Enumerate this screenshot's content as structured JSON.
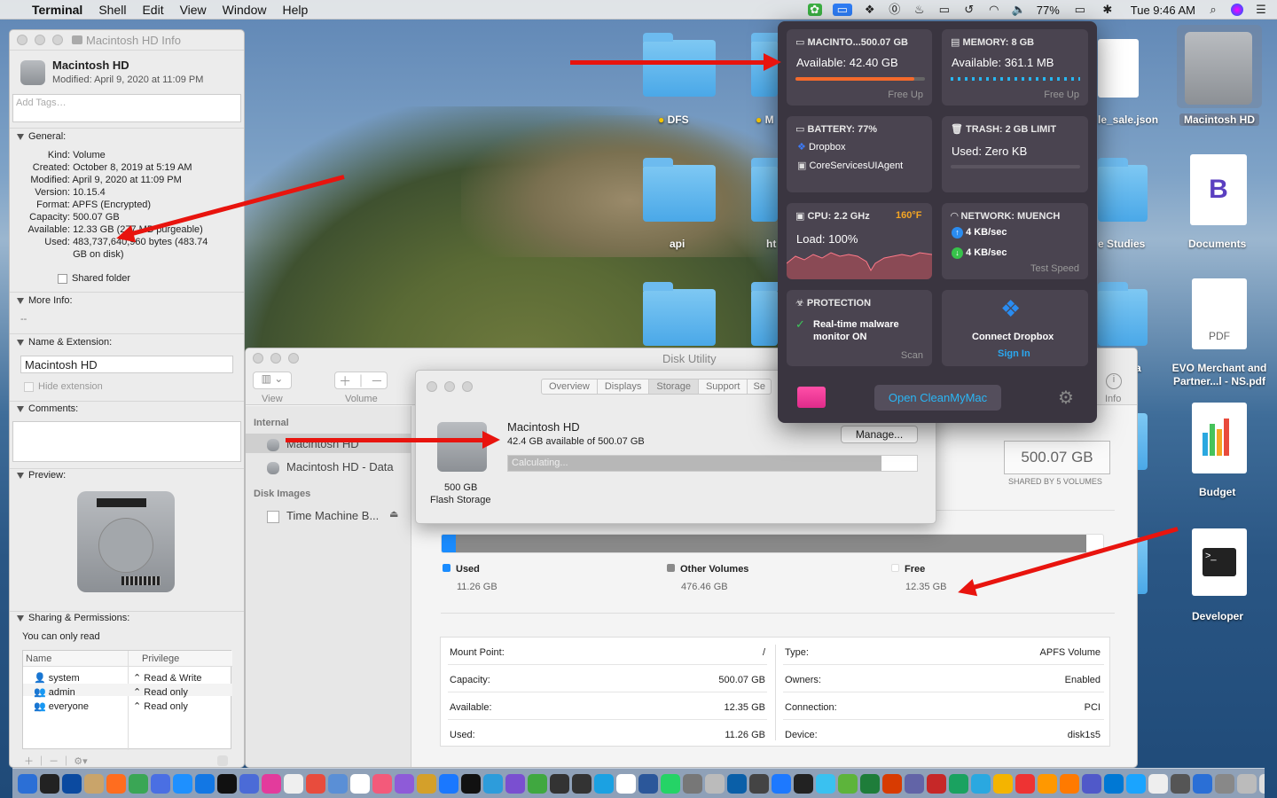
{
  "menubar": {
    "apple": "",
    "app": "Terminal",
    "items": [
      "Shell",
      "Edit",
      "View",
      "Window",
      "Help"
    ],
    "battery": "77%",
    "clock": "Tue 9:46 AM"
  },
  "info": {
    "title": "Macintosh HD Info",
    "name": "Macintosh HD",
    "modified": "Modified: April 9, 2020 at 11:09 PM",
    "tags_placeholder": "Add Tags…",
    "general": "General:",
    "rows": [
      {
        "k": "Kind:",
        "v": "Volume"
      },
      {
        "k": "Created:",
        "v": "October 8, 2019 at 5:19 AM"
      },
      {
        "k": "Modified:",
        "v": "April 9, 2020 at 11:09 PM"
      },
      {
        "k": "Version:",
        "v": "10.15.4"
      },
      {
        "k": "Format:",
        "v": "APFS (Encrypted)"
      },
      {
        "k": "Capacity:",
        "v": "500.07 GB"
      },
      {
        "k": "Available:",
        "v": "12.33 GB (277 MB purgeable)"
      },
      {
        "k": "Used:",
        "v": "483,737,640,960 bytes (483.74"
      }
    ],
    "used_cont": "GB on disk)",
    "shared_folder": "Shared folder",
    "more_info": "More Info:",
    "more_info_val": "--",
    "name_ext": "Name & Extension:",
    "name_value": "Macintosh HD",
    "hide_ext": "Hide extension",
    "comments": "Comments:",
    "preview": "Preview:",
    "sharing": "Sharing & Permissions:",
    "sharing_note": "You can only read",
    "perm_cols": [
      "Name",
      "Privilege"
    ],
    "perms": [
      {
        "n": "system",
        "p": "Read & Write"
      },
      {
        "n": "admin",
        "p": "Read only"
      },
      {
        "n": "everyone",
        "p": "Read only"
      }
    ]
  },
  "du": {
    "title": "Disk Utility",
    "view": "View",
    "volume": "Volume",
    "info": "Info",
    "internal": "Internal",
    "side_items": [
      "Macintosh HD",
      "Macintosh HD - Data"
    ],
    "disk_images": "Disk Images",
    "tm": "Time Machine B...",
    "capacity_box": "500.07 GB",
    "shared_by": "SHARED BY 5 VOLUMES",
    "legend": [
      {
        "l": "Used",
        "v": "11.26 GB",
        "c": "#1a8cff"
      },
      {
        "l": "Other Volumes",
        "v": "476.46 GB",
        "c": "#8a8a8a"
      },
      {
        "l": "Free",
        "v": "12.35 GB",
        "c": "#ffffff"
      }
    ],
    "used_fraction": 0.022,
    "other_fraction": 0.953,
    "left_rows": [
      {
        "k": "Mount Point:",
        "v": "/"
      },
      {
        "k": "Capacity:",
        "v": "500.07 GB"
      },
      {
        "k": "Available:",
        "v": "12.35 GB"
      },
      {
        "k": "Used:",
        "v": "11.26 GB"
      }
    ],
    "right_rows": [
      {
        "k": "Type:",
        "v": "APFS Volume"
      },
      {
        "k": "Owners:",
        "v": "Enabled"
      },
      {
        "k": "Connection:",
        "v": "PCI"
      },
      {
        "k": "Device:",
        "v": "disk1s5"
      }
    ]
  },
  "sheet": {
    "tabs": [
      "Overview",
      "Displays",
      "Storage",
      "Support",
      "Se"
    ],
    "active_tab": "Storage",
    "name": "Macintosh HD",
    "avail": "42.4 GB available of 500.07 GB",
    "calc": "Calculating...",
    "manage": "Manage...",
    "size": "500 GB",
    "type": "Flash Storage"
  },
  "cmm": {
    "disk_h": "MACINTO...500.07 GB",
    "disk_v": "Available: 42.40 GB",
    "disk_f": "Free Up",
    "disk_fraction": 0.92,
    "mem_h": "MEMORY: 8 GB",
    "mem_v": "Available: 361.1 MB",
    "mem_f": "Free Up",
    "bat_h": "BATTERY: 77%",
    "bat_apps": [
      "Dropbox",
      "CoreServicesUIAgent"
    ],
    "trash_h": "TRASH: 2 GB LIMIT",
    "trash_v": "Used: Zero KB",
    "cpu_h": "CPU: 2.2 GHz",
    "cpu_t": "160°F",
    "cpu_v": "Load: 100%",
    "net_h": "NETWORK: MUENCH",
    "net_up": "4 KB/sec",
    "net_down": "4 KB/sec",
    "net_f": "Test Speed",
    "prot_h": "PROTECTION",
    "prot_v": "Real-time malware monitor ON",
    "prot_f": "Scan",
    "dbx_h": "Connect Dropbox",
    "dbx_f": "Sign In",
    "open": "Open CleanMyMac"
  },
  "desktop": {
    "folders": [
      "DFS",
      "M",
      "api",
      "ht"
    ],
    "right": [
      "Macintosh HD",
      "le_sale.json",
      "e Studies",
      "Documents",
      "EVO Merchant and Partner...l - NS.pdf",
      "Budget",
      "Developer",
      "t_da"
    ],
    "pdf": "PDF"
  }
}
